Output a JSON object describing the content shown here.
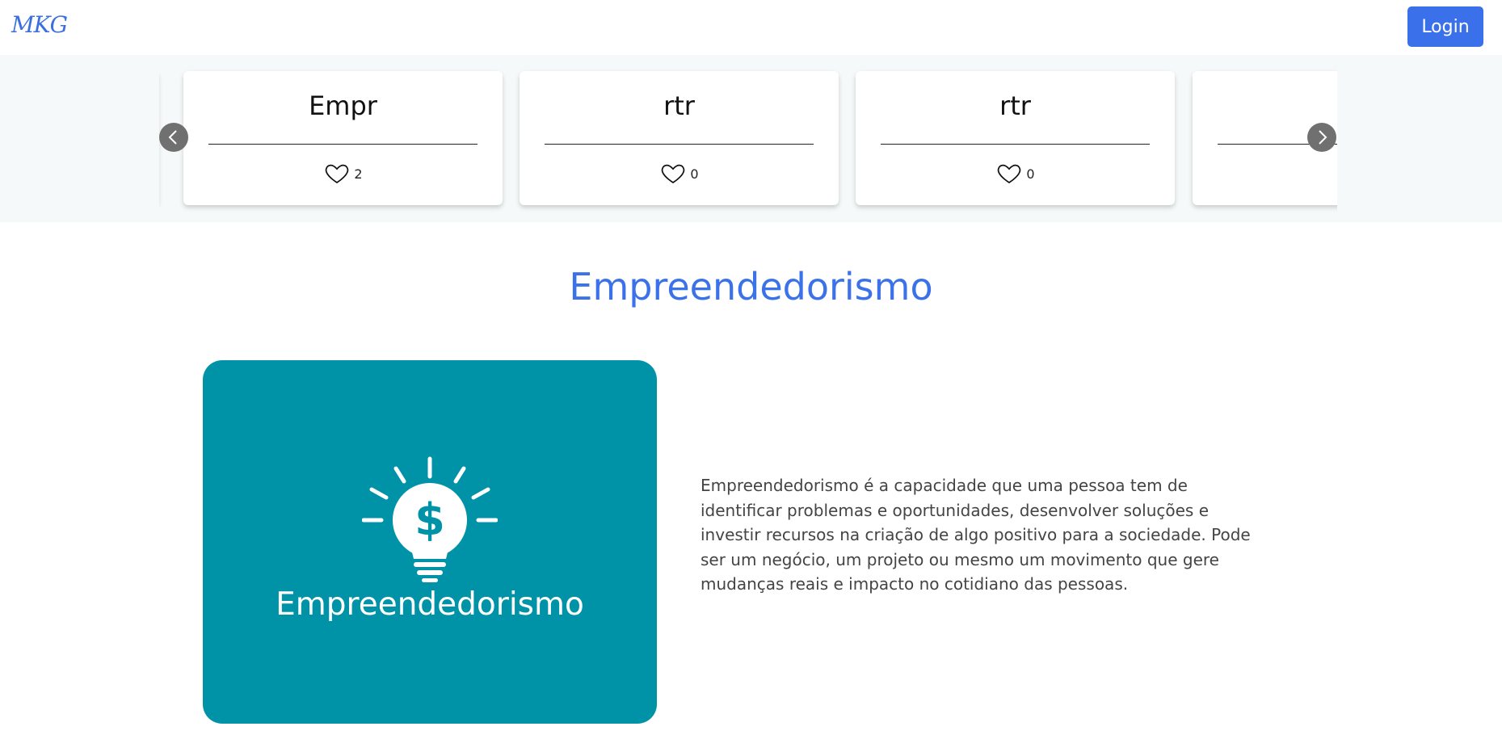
{
  "navbar": {
    "logo": "MKG",
    "login_label": "Login"
  },
  "carousel": {
    "cards": [
      {
        "title": "Empr",
        "likes": "2"
      },
      {
        "title": "rtr",
        "likes": "0"
      },
      {
        "title": "rtr",
        "likes": "0"
      }
    ],
    "prev_icon": "chevron-left-icon",
    "next_icon": "chevron-right-icon"
  },
  "section": {
    "title": "Empreendedorismo",
    "image_caption": "Empreendedorismo",
    "image_icon": "lightbulb-dollar-icon",
    "description": "Empreendedorismo é a capacidade que uma pessoa tem de identificar problemas e oportunidades, desenvolver soluções e investir recursos na criação de algo positivo para a sociedade. Pode ser um negócio, um projeto ou mesmo um movimento que gere mudanças reais e impacto no cotidiano das pessoas."
  },
  "colors": {
    "accent": "#3a71ea",
    "image_bg": "#0093a7",
    "carousel_bg": "#f5f9f9"
  }
}
